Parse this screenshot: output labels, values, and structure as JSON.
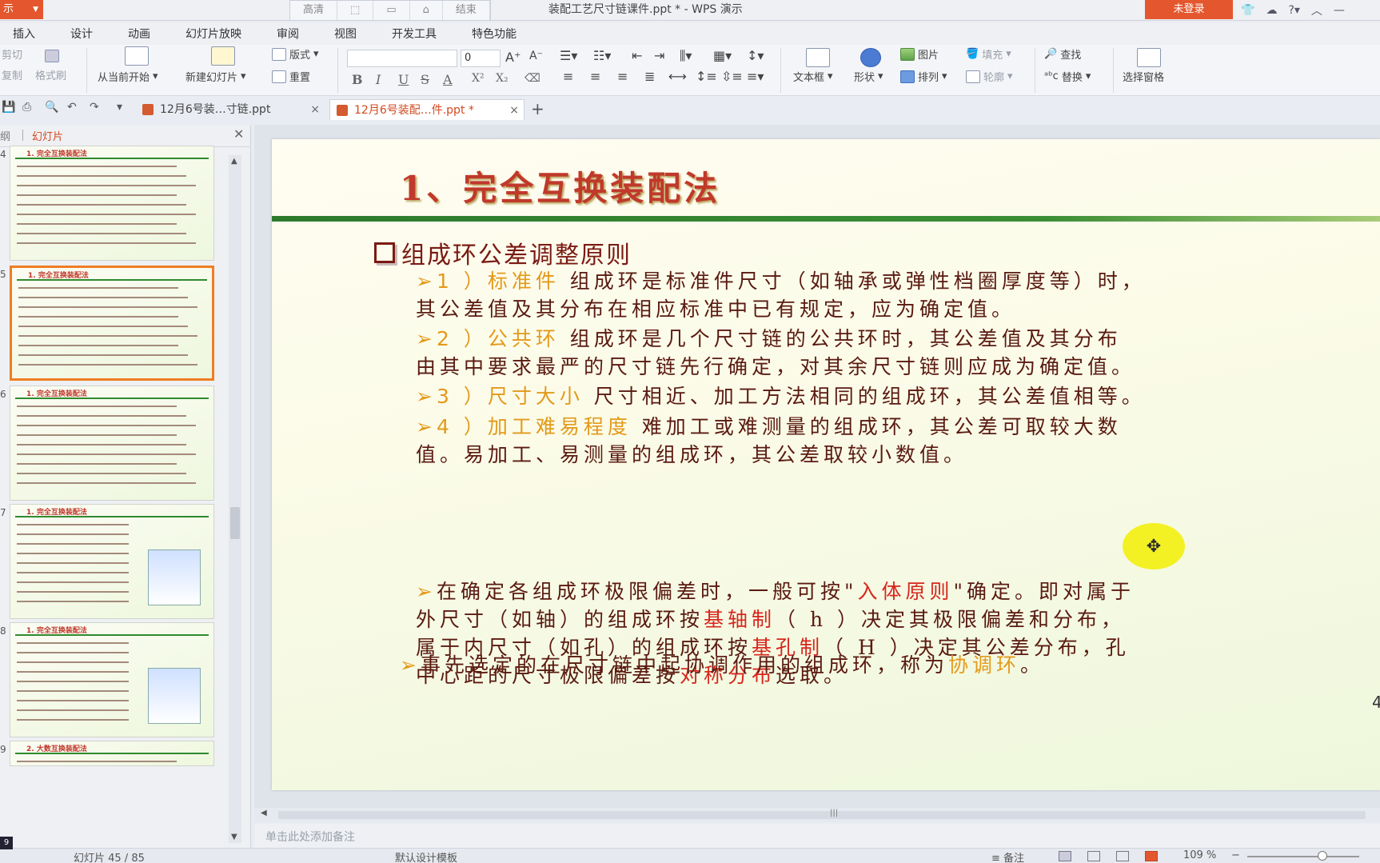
{
  "titlebar": {
    "app_menu": "示",
    "quick_modes": [
      "高清",
      "",
      "",
      "",
      "结束"
    ],
    "window_title": "装配工艺尺寸链课件.ppt * - WPS 演示",
    "login": "未登录"
  },
  "ribbon_tabs": [
    "插入",
    "设计",
    "动画",
    "幻灯片放映",
    "审阅",
    "视图",
    "开发工具",
    "特色功能"
  ],
  "ribbon": {
    "cut": "剪切",
    "copy": "复制",
    "format_painter": "格式刷",
    "from_current": "从当前开始",
    "new_slide": "新建幻灯片",
    "layout": "版式",
    "reset": "重置",
    "font_size": "0",
    "textbox": "文本框",
    "shape": "形状",
    "picture": "图片",
    "arrange": "排列",
    "fill": "填充",
    "outline": "轮廓",
    "find": "查找",
    "replace": "替换",
    "selection_pane": "选择窗格"
  },
  "doc_tabs": [
    {
      "label": "12月6号装…寸链.ppt",
      "active": false
    },
    {
      "label": "12月6号装配…件.ppt *",
      "active": true
    }
  ],
  "panel": {
    "outline_tab": "纲",
    "slides_tab": "幻灯片"
  },
  "thumbnails": [
    {
      "num": "4",
      "title": "1. 完全互换装配法",
      "selected": false,
      "has_figure": false
    },
    {
      "num": "5",
      "title": "1. 完全互换装配法",
      "selected": true,
      "has_figure": false
    },
    {
      "num": "6",
      "title": "1. 完全互换装配法",
      "selected": false,
      "has_figure": false
    },
    {
      "num": "7",
      "title": "1. 完全互换装配法",
      "selected": false,
      "has_figure": true
    },
    {
      "num": "8",
      "title": "1. 完全互换装配法",
      "selected": false,
      "has_figure": true
    },
    {
      "num": "9",
      "title": "2. 大数互换装配法",
      "selected": false,
      "has_figure": false
    }
  ],
  "slide": {
    "title": "1、完全互换装配法",
    "heading": "组成环公差调整原则",
    "items": [
      {
        "bullet": "➢1 ）",
        "key": "标准件",
        "line1": "   组成环是标准件尺寸（如轴承或弹性档圈厚度等）时，",
        "line2": "其公差值及其分布在相应标准中已有规定，应为确定值。"
      },
      {
        "bullet": "➢2 ）",
        "key": "公共环",
        "line1": "   组成环是几个尺寸链的公共环时，其公差值及其分布",
        "line2": "由其中要求最严的尺寸链先行确定，对其余尺寸链则应成为确定值。"
      },
      {
        "bullet": "➢3 ）",
        "key": "尺寸大小",
        "line1": "   尺寸相近、加工方法相同的组成环，其公差值相等。",
        "line2": ""
      },
      {
        "bullet": "➢4 ）",
        "key": "加工难易程度",
        "line1": "   难加工或难测量的组成环，其公差可取较大数",
        "line2": "值。易加工、易测量的组成环，其公差取较小数值。"
      }
    ],
    "p5": {
      "bullet": "➢",
      "a": "在确定各组成环极限偏差时，一般可按\"",
      "b": "入体原则",
      "c": "\"确定。即对属于",
      "d": "外尺寸（如轴）的组成环按",
      "e": "基轴制",
      "f": "（ h ）决定其极限偏差和分布，",
      "g": "属于内尺寸（如孔）的组成环按",
      "h": "基孔制",
      "i": "（ H ）决定其公差分布，孔",
      "j": "中心距的尺寸极限偏差按",
      "k": "对称分布",
      "l": "选取。"
    },
    "p6": {
      "bullet": "➢",
      "a": "事先选定的在尺寸链中起协调作用的组成环，称为",
      "b": "协调环",
      "c": "。"
    },
    "edge_number": "4"
  },
  "notes_placeholder": "单击此处添加备注",
  "status": {
    "slide_counter": "幻灯片 45 / 85",
    "template": "默认设计模板",
    "notes": "备注",
    "zoom": "109 %",
    "badge": "9"
  },
  "colors": {
    "accent": "#e4572e",
    "title_red": "#c0392b",
    "body_brown": "#5a1a10",
    "highlight_orange": "#e39a1a",
    "highlight_red": "#d8261d",
    "rule_green": "#2d7a2d"
  }
}
